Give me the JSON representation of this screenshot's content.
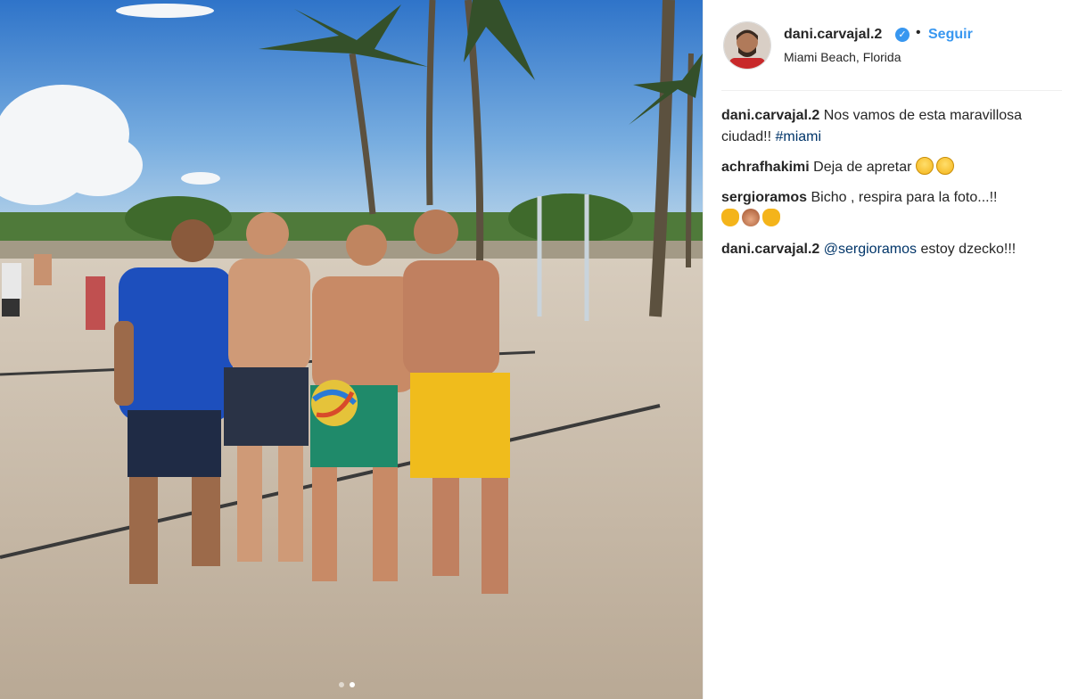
{
  "post": {
    "username": "dani.carvajal.2",
    "verified_icon": "verified-badge-icon",
    "separator": "•",
    "follow_label": "Seguir",
    "location": "Miami Beach, Florida"
  },
  "comments": [
    {
      "user": "dani.carvajal.2",
      "text": "Nos vamos de esta maravillosa ciudad!!",
      "hashtag": "#miami"
    },
    {
      "user": "achrafhakimi",
      "text": "Deja de apretar",
      "emojis": [
        "flushed-face-icon",
        "flushed-face-icon"
      ]
    },
    {
      "user": "sergioramos",
      "text": "Bicho , respira para la foto...!!",
      "emojis": [
        "clapping-hands-icon",
        "see-no-evil-monkey-icon",
        "clapping-hands-icon"
      ]
    },
    {
      "user": "dani.carvajal.2",
      "mention": "@sergioramos",
      "text": "estoy dzecko!!!"
    }
  ],
  "carousel": {
    "count": 2,
    "active": 2
  },
  "colors": {
    "link": "#3897f0",
    "hashtag": "#003569",
    "text": "#262626"
  }
}
